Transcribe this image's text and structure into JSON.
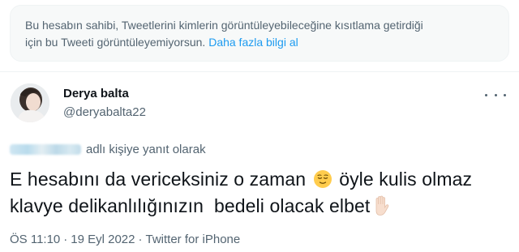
{
  "notice": {
    "line1": "Bu hesabın sahibi, Tweetlerini kimlerin görüntüleyebileceğine kısıtlama getirdiği",
    "line2": "için bu Tweeti görüntüleyemiyorsun.",
    "link": "Daha fazla bilgi al"
  },
  "tweet": {
    "author": {
      "display_name": "Derya balta",
      "handle": "@deryabalta22"
    },
    "reply_to_suffix": "adlı kişiye yanıt olarak",
    "text_line1_a": "E hesabını da vericeksiniz o zaman ",
    "text_line1_b": " öyle kulis olmaz",
    "text_line2": "klavye delikanlılığınızın  bedeli olacak elbet",
    "emojis": [
      "relieved-face-emoji",
      "raised-hand-emoji"
    ],
    "time": "ÖS 11:10",
    "separator": "·",
    "date": "19 Eyl 2022",
    "source": "Twitter for iPhone"
  },
  "colors": {
    "text_primary": "#0f1419",
    "text_secondary": "#536471",
    "link": "#1d9bf0",
    "notice_bg": "#f7f9f9",
    "divider": "#eff3f4"
  },
  "icons": {
    "more": "more-dots-icon"
  }
}
